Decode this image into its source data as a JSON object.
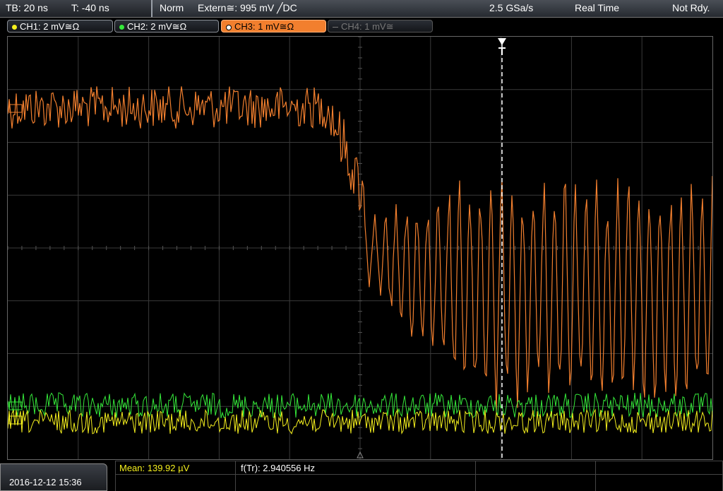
{
  "topbar": {
    "timebase": "TB: 20 ns",
    "trigger_time": "T: -40 ns",
    "trigger_mode": "Norm",
    "trigger_source": "Extern≅: 995 mV ╱DC",
    "sample_rate": "2.5 GSa/s",
    "acq_mode": "Real Time",
    "status": "Not Rdy."
  },
  "channels": [
    {
      "label": "CH1: 2 mV≅Ω",
      "color": "#f5f01e",
      "state": "on"
    },
    {
      "label": "CH2: 2 mV≅Ω",
      "color": "#35e83a",
      "state": "on"
    },
    {
      "label": "CH3: 1 mV≅Ω",
      "color": "#f27f2e",
      "state": "active"
    },
    {
      "label": "CH4: 1 mV≅",
      "color": "#777777",
      "state": "off"
    }
  ],
  "bottombar": {
    "datetime": "2016-12-12 15:36",
    "mean": "Mean: 139.92 µV",
    "frequency": "f(Tr): 2.940556 Hz"
  },
  "colors": {
    "ch1": "#f5f01e",
    "ch2": "#35e83a",
    "ch3": "#f27f2e",
    "grid": "#3a3a3a",
    "trigger_marker": "#ffffff"
  },
  "icons": {
    "trigger_marker": "trigger-down-arrow-icon",
    "channel_indicator": "circle-dot-icon"
  }
}
